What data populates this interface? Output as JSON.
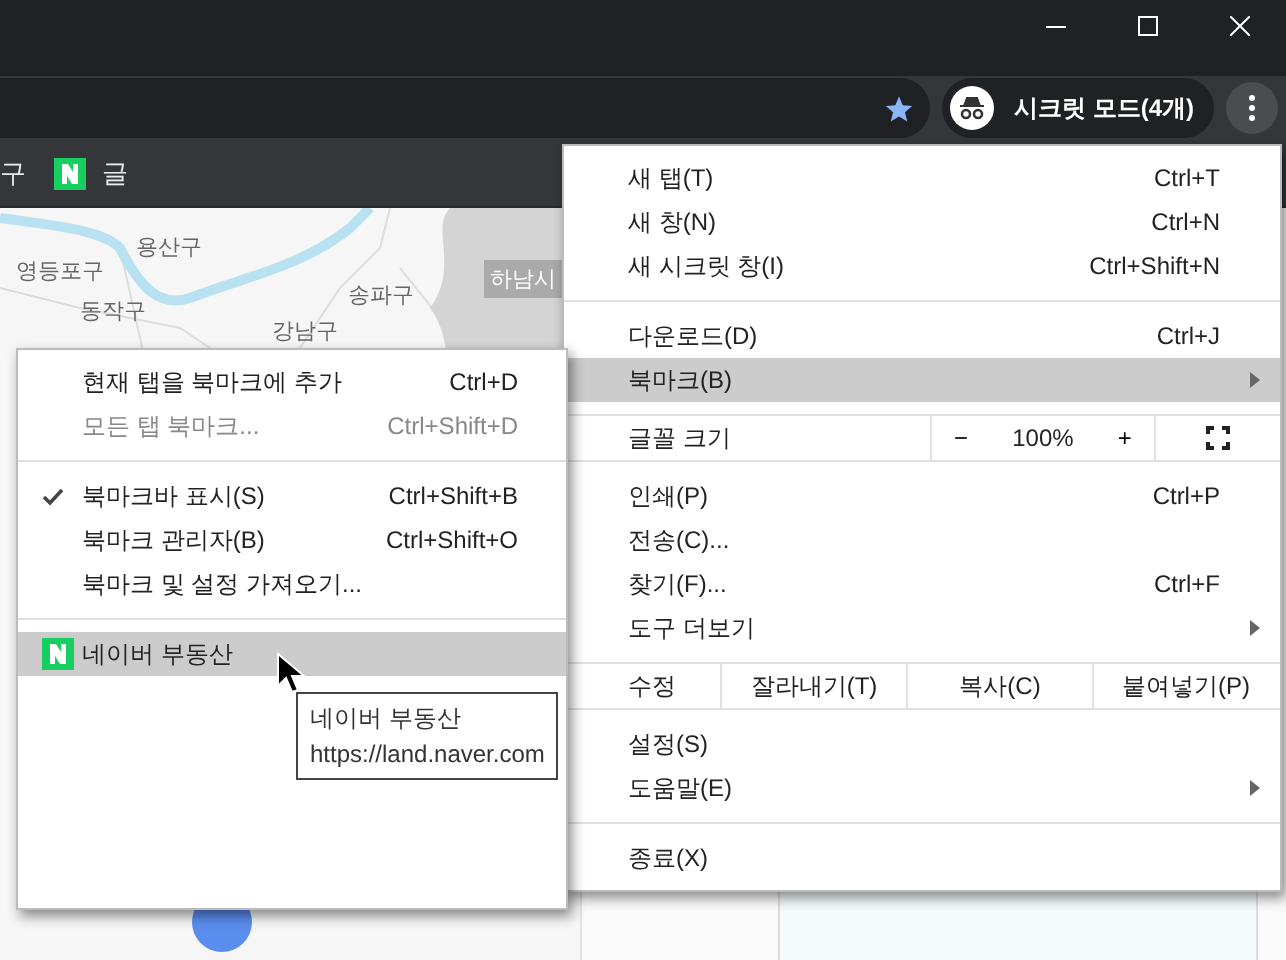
{
  "toolbar": {
    "profile": {
      "label": "시크릿 모드(4개)"
    }
  },
  "bookmarks_bar": {
    "items": [
      {
        "kind": "text",
        "label": "구"
      },
      {
        "kind": "naver",
        "label": "글"
      }
    ]
  },
  "map": {
    "labels": [
      {
        "text": "용산구",
        "kind": "district"
      },
      {
        "text": "영등포구",
        "kind": "district"
      },
      {
        "text": "동작구",
        "kind": "district"
      },
      {
        "text": "송파구",
        "kind": "district"
      },
      {
        "text": "강남구",
        "kind": "district"
      },
      {
        "text": "하남시",
        "kind": "city"
      }
    ]
  },
  "main_menu": {
    "sections": [
      [
        {
          "kind": "item",
          "label": "새 탭(T)",
          "shortcut": "Ctrl+T",
          "submenu": false,
          "highlighted": false
        },
        {
          "kind": "item",
          "label": "새 창(N)",
          "shortcut": "Ctrl+N",
          "submenu": false,
          "highlighted": false
        },
        {
          "kind": "item",
          "label": "새 시크릿 창(I)",
          "shortcut": "Ctrl+Shift+N",
          "submenu": false,
          "highlighted": false
        }
      ],
      [
        {
          "kind": "item",
          "label": "다운로드(D)",
          "shortcut": "Ctrl+J",
          "submenu": false,
          "highlighted": false
        },
        {
          "kind": "item",
          "label": "북마크(B)",
          "submenu": true,
          "highlighted": true
        }
      ],
      [
        {
          "kind": "zoom",
          "label": "글꼴 크기",
          "minus": "−",
          "value": "100%",
          "plus": "+"
        }
      ],
      [
        {
          "kind": "item",
          "label": "인쇄(P)",
          "shortcut": "Ctrl+P",
          "submenu": false,
          "highlighted": false
        },
        {
          "kind": "item",
          "label": "전송(C)...",
          "submenu": false,
          "highlighted": false
        },
        {
          "kind": "item",
          "label": "찾기(F)...",
          "shortcut": "Ctrl+F",
          "submenu": false,
          "highlighted": false
        },
        {
          "kind": "item",
          "label": "도구 더보기",
          "submenu": true,
          "highlighted": false
        }
      ],
      [
        {
          "kind": "edit",
          "label": "수정",
          "buttons": [
            "잘라내기(T)",
            "복사(C)",
            "붙여넣기(P)"
          ]
        }
      ],
      [
        {
          "kind": "item",
          "label": "설정(S)",
          "submenu": false,
          "highlighted": false
        },
        {
          "kind": "item",
          "label": "도움말(E)",
          "submenu": true,
          "highlighted": false
        }
      ],
      [
        {
          "kind": "item",
          "label": "종료(X)",
          "submenu": false,
          "highlighted": false
        }
      ]
    ]
  },
  "bookmark_menu": {
    "sections": [
      [
        {
          "kind": "item",
          "label": "현재 탭을 북마크에 추가",
          "shortcut": "Ctrl+D",
          "disabled": false,
          "checked": false,
          "highlighted": false
        },
        {
          "kind": "item",
          "label": "모든 탭 북마크...",
          "shortcut": "Ctrl+Shift+D",
          "disabled": true,
          "checked": false,
          "highlighted": false
        }
      ],
      [
        {
          "kind": "item",
          "label": "북마크바 표시(S)",
          "shortcut": "Ctrl+Shift+B",
          "disabled": false,
          "checked": true,
          "highlighted": false
        },
        {
          "kind": "item",
          "label": "북마크 관리자(B)",
          "shortcut": "Ctrl+Shift+O",
          "disabled": false,
          "checked": false,
          "highlighted": false
        },
        {
          "kind": "item",
          "label": "북마크 및 설정 가져오기...",
          "disabled": false,
          "checked": false,
          "highlighted": false
        }
      ],
      [
        {
          "kind": "bookmark",
          "label": "네이버 부동산",
          "disabled": false,
          "checked": false,
          "highlighted": true
        }
      ]
    ]
  },
  "tooltip": {
    "title": "네이버 부동산",
    "url": "https://land.naver.com"
  }
}
